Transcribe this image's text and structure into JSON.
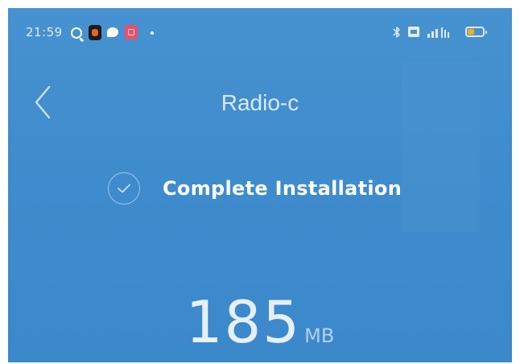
{
  "status_bar": {
    "time": "21:59",
    "notification_icons": [
      "search-icon",
      "app-icon-black",
      "chat-icon",
      "app-icon-red",
      "dot-icon"
    ],
    "system_icons": [
      "bluetooth-icon",
      "sim-icon",
      "signal-icon",
      "battery-icon"
    ],
    "battery_color": "#f0b419"
  },
  "header": {
    "back_icon": "chevron-left-icon",
    "title": "Radio-c"
  },
  "install": {
    "status_icon": "check-circle-icon",
    "status_text": "Complete Installation"
  },
  "download": {
    "size_value": "185",
    "size_unit": "MB"
  },
  "colors": {
    "background": "#4290ce",
    "text": "#ffffff"
  }
}
